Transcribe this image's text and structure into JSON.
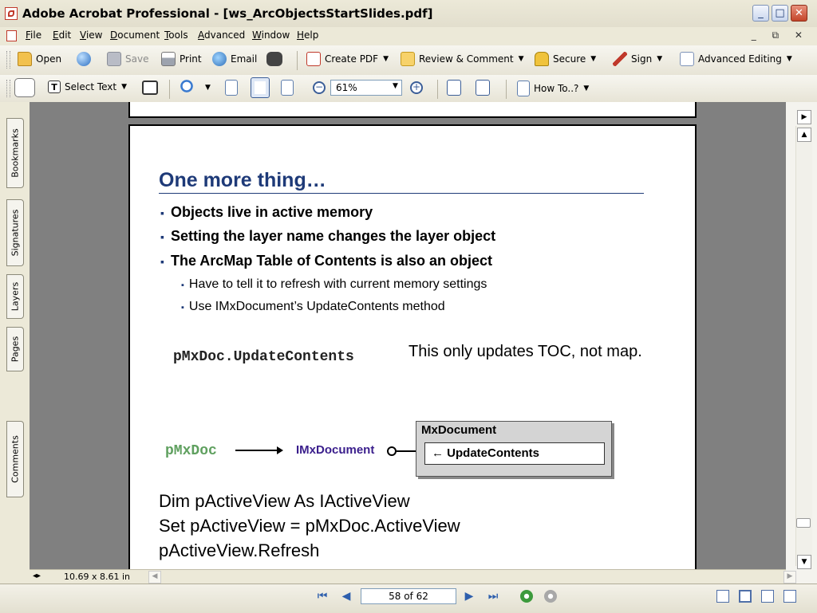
{
  "window": {
    "title": "Adobe Acrobat Professional - [ws_ArcObjectsStartSlides.pdf]",
    "minimize": "_",
    "maximize": "□",
    "close": "✕"
  },
  "menu": {
    "items": [
      {
        "label": "File",
        "u": "F",
        "rest": "ile"
      },
      {
        "label": "Edit",
        "u": "E",
        "rest": "dit"
      },
      {
        "label": "View",
        "u": "V",
        "rest": "iew"
      },
      {
        "label": "Document",
        "u": "D",
        "rest": "ocument"
      },
      {
        "label": "Tools",
        "u": "T",
        "rest": "ools"
      },
      {
        "label": "Advanced",
        "u": "A",
        "rest": "dvanced"
      },
      {
        "label": "Window",
        "u": "W",
        "rest": "indow"
      },
      {
        "label": "Help",
        "u": "H",
        "rest": "elp"
      }
    ],
    "doc_controls": "_ ⧉ ✕"
  },
  "toolbar1": {
    "open": "Open",
    "save": "Save",
    "print": "Print",
    "email": "Email",
    "create_pdf": "Create PDF",
    "review": "Review & Comment",
    "secure": "Secure",
    "sign": "Sign",
    "advanced_editing": "Advanced Editing"
  },
  "toolbar2": {
    "select_text": "Select Text",
    "zoom_value": "61%",
    "how_to": "How To..?",
    "zoom_out": "−",
    "zoom_in": "+"
  },
  "nav_tabs": {
    "bookmarks": "Bookmarks",
    "signatures": "Signatures",
    "layers": "Layers",
    "pages": "Pages",
    "comments": "Comments"
  },
  "slide": {
    "title": "One more thing…",
    "bullets": [
      "Objects live in active memory",
      "Setting the layer name changes the layer object",
      "The ArcMap Table of Contents is also an object"
    ],
    "sub_bullets": [
      "Have to tell it to refresh with current memory settings",
      "Use IMxDocument’s UpdateContents method"
    ],
    "code": "pMxDoc.UpdateContents",
    "note": "This only updates TOC, not map.",
    "diagram": {
      "source": "pMxDoc",
      "interface": "IMxDocument",
      "class": "MxDocument",
      "method": "← UpdateContents"
    },
    "code_lines": [
      "Dim pActiveView As IActiveView",
      "Set pActiveView = pMxDoc.ActiveView",
      "pActiveView.Refresh"
    ]
  },
  "status": {
    "page_size": "10.69 x 8.61 in",
    "page_indicator": "58 of 62"
  }
}
